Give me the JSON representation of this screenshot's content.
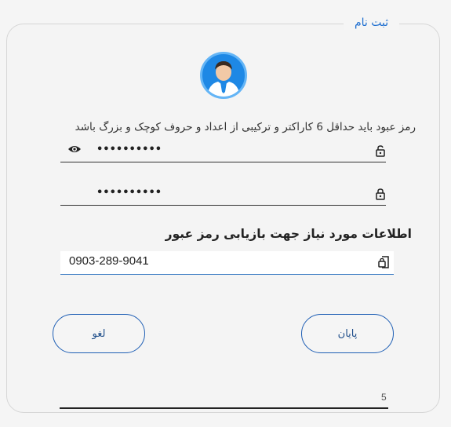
{
  "form": {
    "legend": "ثبت نام",
    "avatar_icon": "user-avatar-icon",
    "password_hint": "رمز عبود باید حداقل 6 کاراکتر و ترکیبی از اعداد و حروف کوچک و بزرگ باشد",
    "password": {
      "value": "••••••••••",
      "eye_icon": "eye-icon",
      "lock_icon": "lock-open-icon"
    },
    "password_confirm": {
      "value": "••••••••••",
      "lock_icon": "lock-icon"
    },
    "recovery_title": "اطلاعات مورد نیاز جهت بازیابی رمز عبور",
    "phone": {
      "value": "0903-289-9041",
      "icon": "phone-lock-icon"
    },
    "buttons": {
      "finish": "پایان",
      "cancel": "لغو"
    },
    "counter": "5"
  },
  "colors": {
    "accent": "#1f6fd0",
    "avatar_bg": "#1e88e5",
    "border": "#d6d6d6"
  }
}
